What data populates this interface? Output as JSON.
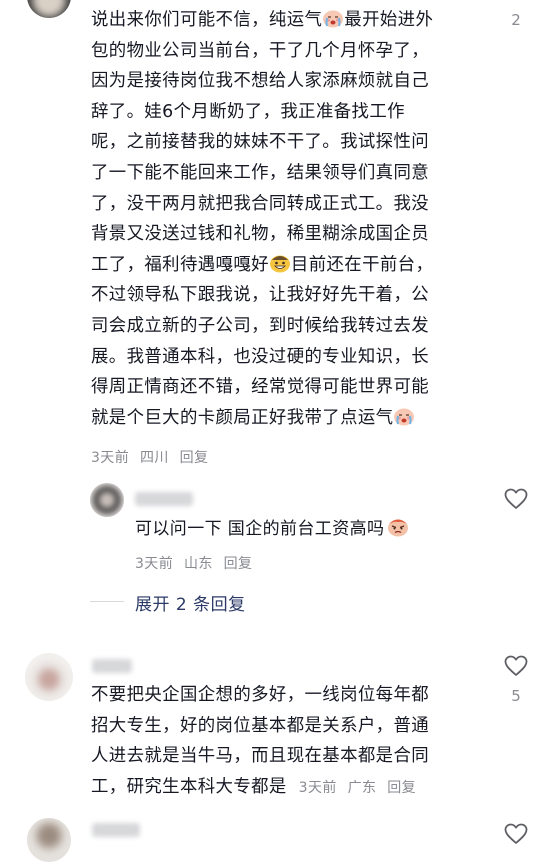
{
  "comments": [
    {
      "lines": [
        "说出来你们可能不信，纯运气",
        "最开始进外",
        "包的物业公司当前台，干了几个月怀孕了，",
        "因为是接待岗位我不想给人家添麻烦就自己",
        "辞了。娃6个月断奶了，我正准备找工作",
        "呢，之前接替我的妹妹不干了。我试探性问",
        "了一下能不能回来工作，结果领导们真同意",
        "了，没干两月就把我合同转成正式工。我没",
        "背景又没送过钱和礼物，稀里糊涂成国企员",
        "工了，福利待遇嘎嘎好",
        "目前还在干前台，",
        "不过领导私下跟我说，让我好好先干着，公",
        "司会成立新的子公司，到时候给我转过去发",
        "展。我普通本科，也没过硬的专业知识，长",
        "得周正情商还不错，经常觉得可能世界可能",
        "就是个巨大的卡颜局正好我带了点运气"
      ],
      "meta_time": "3天前",
      "meta_location": "四川",
      "meta_reply": "回复",
      "like_count": "2"
    },
    {
      "text_a": "可以问一下 国企的前台工资高吗",
      "meta_time": "3天前",
      "meta_location": "山东",
      "meta_reply": "回复"
    },
    {
      "lines": [
        "不要把央企国企想的多好，一线岗位每年都",
        "招大专生，好的岗位基本都是关系户，普通",
        "人进去就是当牛马，而且现在基本都是合同",
        "工，研究生本科大专都是"
      ],
      "meta_time": "3天前",
      "meta_location": "广东",
      "meta_reply": "回复",
      "like_count": "5"
    }
  ],
  "expand_label": "展开 2 条回复",
  "colors": {
    "text": "#161823",
    "meta": "#8a8b91",
    "link": "#2b3a67"
  }
}
